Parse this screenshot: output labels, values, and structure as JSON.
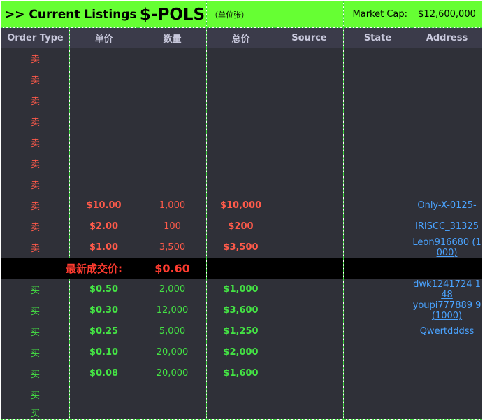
{
  "title": {
    "prefix": ">> Current Listings:",
    "ticker": "$-POLS",
    "unit": "（单位张）",
    "market_cap_label": "Market Cap:",
    "market_cap_value": "$12,600,000"
  },
  "columns": [
    "Order Type",
    "单价",
    "数量",
    "总价",
    "Source",
    "State",
    "Address"
  ],
  "sell_orders": [
    {
      "type": "卖",
      "price": "",
      "qty": "",
      "total": "",
      "source": "",
      "state": "",
      "address": ""
    },
    {
      "type": "卖",
      "price": "",
      "qty": "",
      "total": "",
      "source": "",
      "state": "",
      "address": ""
    },
    {
      "type": "卖",
      "price": "",
      "qty": "",
      "total": "",
      "source": "",
      "state": "",
      "address": ""
    },
    {
      "type": "卖",
      "price": "",
      "qty": "",
      "total": "",
      "source": "",
      "state": "",
      "address": ""
    },
    {
      "type": "卖",
      "price": "",
      "qty": "",
      "total": "",
      "source": "",
      "state": "",
      "address": ""
    },
    {
      "type": "卖",
      "price": "",
      "qty": "",
      "total": "",
      "source": "",
      "state": "",
      "address": ""
    },
    {
      "type": "卖",
      "price": "",
      "qty": "",
      "total": "",
      "source": "",
      "state": "",
      "address": ""
    },
    {
      "type": "卖",
      "price": "$10.00",
      "qty": "1,000",
      "total": "$10,000",
      "source": "",
      "state": "",
      "address": "Only-X-0125-"
    },
    {
      "type": "卖",
      "price": "$2.00",
      "qty": "100",
      "total": "$200",
      "source": "",
      "state": "",
      "address": "IRISCC_31325"
    },
    {
      "type": "卖",
      "price": "$1.00",
      "qty": "3,500",
      "total": "$3,500",
      "source": "",
      "state": "",
      "address": "Leon916680 (1000)"
    }
  ],
  "latest_trade": {
    "label": "最新成交价:",
    "value": "$0.60"
  },
  "buy_orders": [
    {
      "type": "买",
      "price": "$0.50",
      "qty": "2,000",
      "total": "$1,000",
      "source": "",
      "state": "",
      "address": "dwk1241724 148"
    },
    {
      "type": "买",
      "price": "$0.30",
      "qty": "12,000",
      "total": "$3,600",
      "source": "",
      "state": "",
      "address": "youpi777889 9 (1000)"
    },
    {
      "type": "买",
      "price": "$0.25",
      "qty": "5,000",
      "total": "$1,250",
      "source": "",
      "state": "",
      "address": "Qwertdddss"
    },
    {
      "type": "买",
      "price": "$0.10",
      "qty": "20,000",
      "total": "$2,000",
      "source": "",
      "state": "",
      "address": ""
    },
    {
      "type": "买",
      "price": "$0.08",
      "qty": "20,000",
      "total": "$1,600",
      "source": "",
      "state": "",
      "address": ""
    },
    {
      "type": "买",
      "price": "",
      "qty": "",
      "total": "",
      "source": "",
      "state": "",
      "address": ""
    },
    {
      "type": "买",
      "price": "",
      "qty": "",
      "total": "",
      "source": "",
      "state": "",
      "address": ""
    }
  ],
  "colors": {
    "title_bg": "#66ff33",
    "table_bg": "#2f3038",
    "header_bg": "#3b3b4a",
    "sell": "#ff5a4a",
    "buy": "#44e344",
    "latest": "#ff3b2f",
    "link": "#4aa3ff",
    "grid_line": "#3fd43f"
  }
}
